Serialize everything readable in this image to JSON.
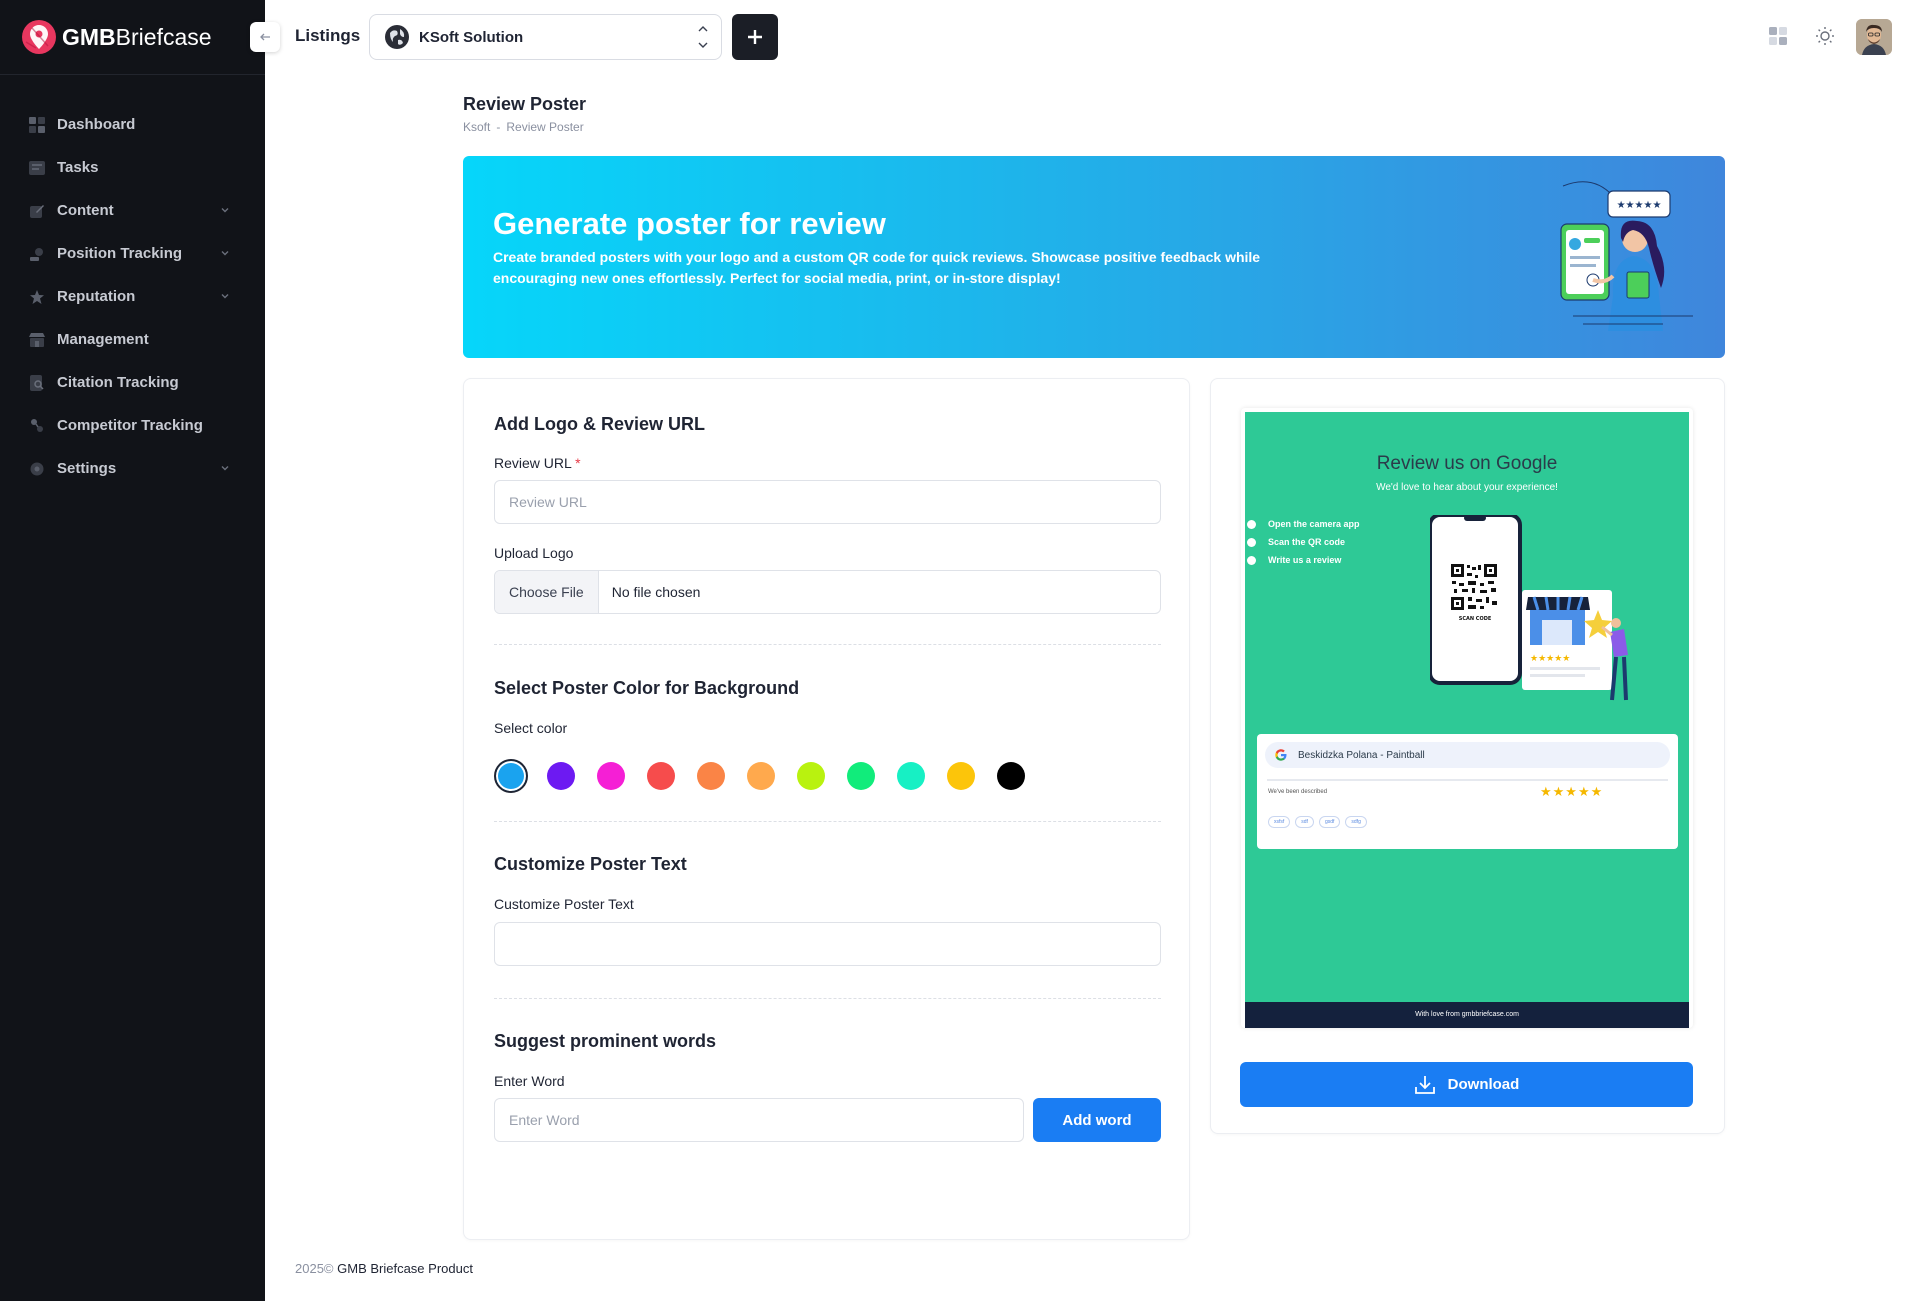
{
  "brand": {
    "name_bold": "GMB",
    "name_regular": "Briefcase"
  },
  "sidebar": {
    "items": [
      {
        "label": "Dashboard",
        "icon": "dashboard-icon",
        "has_submenu": false
      },
      {
        "label": "Tasks",
        "icon": "tasks-icon",
        "has_submenu": false
      },
      {
        "label": "Content",
        "icon": "content-icon",
        "has_submenu": true
      },
      {
        "label": "Position Tracking",
        "icon": "position-tracking-icon",
        "has_submenu": true
      },
      {
        "label": "Reputation",
        "icon": "star-icon",
        "has_submenu": true
      },
      {
        "label": "Management",
        "icon": "store-icon",
        "has_submenu": false
      },
      {
        "label": "Citation Tracking",
        "icon": "citation-icon",
        "has_submenu": false
      },
      {
        "label": "Competitor Tracking",
        "icon": "competitor-icon",
        "has_submenu": false
      },
      {
        "label": "Settings",
        "icon": "settings-icon",
        "has_submenu": true
      }
    ]
  },
  "topbar": {
    "listings_label": "Listings",
    "selected_listing": "KSoft Solution"
  },
  "page": {
    "title": "Review Poster",
    "breadcrumb": [
      "Ksoft",
      "Review Poster"
    ],
    "breadcrumb_sep": "-"
  },
  "banner": {
    "title": "Generate poster for review",
    "description": "Create branded posters with your logo and a custom QR code for quick reviews. Showcase positive feedback while encouraging new ones effortlessly. Perfect for social media, print, or in-store display!"
  },
  "form": {
    "section1_title": "Add Logo & Review URL",
    "review_url_label": "Review URL",
    "review_url_required": "*",
    "review_url_placeholder": "Review URL",
    "review_url_value": "",
    "upload_logo_label": "Upload Logo",
    "choose_file_label": "Choose File",
    "no_file_text": "No file chosen",
    "section2_title": "Select Poster Color for Background",
    "select_color_label": "Select color",
    "colors": [
      "#1aa3ef",
      "#6d1af2",
      "#f51fd5",
      "#f64c4c",
      "#fa8446",
      "#ffa94d",
      "#b9f20f",
      "#11ec7b",
      "#17f0c4",
      "#fcc50a",
      "#000000"
    ],
    "selected_color_index": 0,
    "section3_title": "Customize Poster Text",
    "poster_text_label": "Customize Poster Text",
    "poster_text_value": "",
    "section4_title": "Suggest prominent words",
    "enter_word_label": "Enter Word",
    "enter_word_placeholder": "Enter Word",
    "add_word_label": "Add word"
  },
  "poster": {
    "background": "#2ec996",
    "title": "Review us on Google",
    "subtitle": "We'd love to hear about your experience!",
    "steps": [
      "Open the camera app",
      "Scan the QR code",
      "Write us a review"
    ],
    "scan_label": "SCAN CODE",
    "business_name": "Beskidzka Polana - Paintball",
    "description": "We've been described",
    "stars": "★★★★★",
    "tags": [
      "xsfsf",
      "sdf",
      "gsdf",
      "sdfg"
    ],
    "footer": "With love from gmbbriefcase.com"
  },
  "download_label": "Download",
  "footer": {
    "year": "2025©",
    "text": "GMB Briefcase Product"
  },
  "colors": {
    "primary": "#1a7df3",
    "sidebar_bg": "#111318",
    "dark_button": "#1b1e26"
  }
}
